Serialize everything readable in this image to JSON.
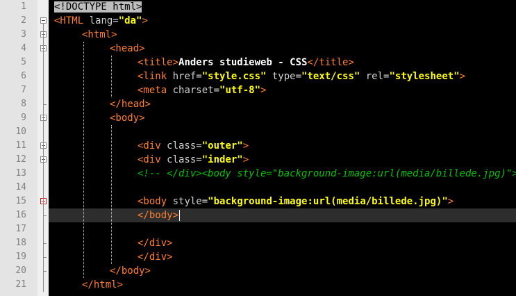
{
  "editor": {
    "lines": [
      {
        "n": "1",
        "indent": 0,
        "segs": [
          {
            "t": "<!DOCTYPE html>",
            "c": "doctype"
          }
        ]
      },
      {
        "n": "2",
        "indent": 0,
        "segs": [
          {
            "t": "<HTML",
            "c": "tag"
          },
          {
            "t": " lang=",
            "c": "attr"
          },
          {
            "t": "\"da\"",
            "c": "val"
          },
          {
            "t": ">",
            "c": "tag"
          }
        ]
      },
      {
        "n": "3",
        "indent": 1,
        "segs": [
          {
            "t": "<html>",
            "c": "tag"
          }
        ]
      },
      {
        "n": "4",
        "indent": 2,
        "segs": [
          {
            "t": "<head>",
            "c": "tag"
          }
        ]
      },
      {
        "n": "5",
        "indent": 3,
        "segs": [
          {
            "t": "<title>",
            "c": "tag"
          },
          {
            "t": "Anders studieweb - CSS",
            "c": "txt"
          },
          {
            "t": "</title>",
            "c": "tag"
          }
        ]
      },
      {
        "n": "6",
        "indent": 3,
        "segs": [
          {
            "t": "<link",
            "c": "tag"
          },
          {
            "t": " href=",
            "c": "attr"
          },
          {
            "t": "\"style.css\"",
            "c": "val"
          },
          {
            "t": " type=",
            "c": "attr"
          },
          {
            "t": "\"text/css\"",
            "c": "val"
          },
          {
            "t": " rel=",
            "c": "attr"
          },
          {
            "t": "\"stylesheet\"",
            "c": "val"
          },
          {
            "t": ">",
            "c": "tag"
          }
        ]
      },
      {
        "n": "7",
        "indent": 3,
        "segs": [
          {
            "t": "<meta",
            "c": "tag"
          },
          {
            "t": " charset=",
            "c": "attr"
          },
          {
            "t": "\"utf-8\"",
            "c": "val"
          },
          {
            "t": ">",
            "c": "tag"
          }
        ]
      },
      {
        "n": "8",
        "indent": 2,
        "segs": [
          {
            "t": "</head>",
            "c": "tag"
          }
        ]
      },
      {
        "n": "9",
        "indent": 2,
        "segs": [
          {
            "t": "<body>",
            "c": "tag"
          }
        ]
      },
      {
        "n": "10",
        "indent": 0,
        "segs": []
      },
      {
        "n": "11",
        "indent": 3,
        "segs": [
          {
            "t": "<div",
            "c": "tag"
          },
          {
            "t": " class=",
            "c": "attr"
          },
          {
            "t": "\"outer\"",
            "c": "val"
          },
          {
            "t": ">",
            "c": "tag"
          }
        ]
      },
      {
        "n": "12",
        "indent": 3,
        "segs": [
          {
            "t": "<div",
            "c": "tag"
          },
          {
            "t": " class=",
            "c": "attr"
          },
          {
            "t": "\"inder\"",
            "c": "val"
          },
          {
            "t": ">",
            "c": "tag"
          }
        ]
      },
      {
        "n": "13",
        "indent": 3,
        "segs": [
          {
            "t": "<!-- </div><body style=\"background-image:url(media/billede.jpg)\">",
            "c": "cmt"
          }
        ]
      },
      {
        "n": "14",
        "indent": 0,
        "segs": []
      },
      {
        "n": "15",
        "indent": 3,
        "segs": [
          {
            "t": "<body",
            "c": "tag"
          },
          {
            "t": " style=",
            "c": "attr"
          },
          {
            "t": "\"background-image:url(media/billede.jpg)\"",
            "c": "val"
          },
          {
            "t": ">",
            "c": "tag"
          }
        ]
      },
      {
        "n": "16",
        "indent": 3,
        "segs": [
          {
            "t": "</body>",
            "c": "tag"
          }
        ]
      },
      {
        "n": "17",
        "indent": 0,
        "segs": []
      },
      {
        "n": "18",
        "indent": 3,
        "segs": [
          {
            "t": "</div>",
            "c": "tag"
          }
        ]
      },
      {
        "n": "19",
        "indent": 3,
        "segs": [
          {
            "t": "</div>",
            "c": "tag"
          }
        ]
      },
      {
        "n": "20",
        "indent": 2,
        "segs": [
          {
            "t": "</body>",
            "c": "tag"
          }
        ]
      },
      {
        "n": "21",
        "indent": 1,
        "segs": [
          {
            "t": "</html>",
            "c": "tag"
          }
        ]
      }
    ],
    "fold_markers": {
      "2": "minus",
      "3": "minus",
      "4": "minus",
      "9": "minus",
      "11": "minus",
      "12": "minus",
      "15": "minus-red"
    },
    "current_line": "16",
    "colors": {
      "background": "#000000",
      "tag": "#ff8030",
      "attribute": "#d0d0d0",
      "value": "#ffff00",
      "text": "#ffffff",
      "comment": "#00c000",
      "current_line": "#2d2d2d"
    }
  }
}
